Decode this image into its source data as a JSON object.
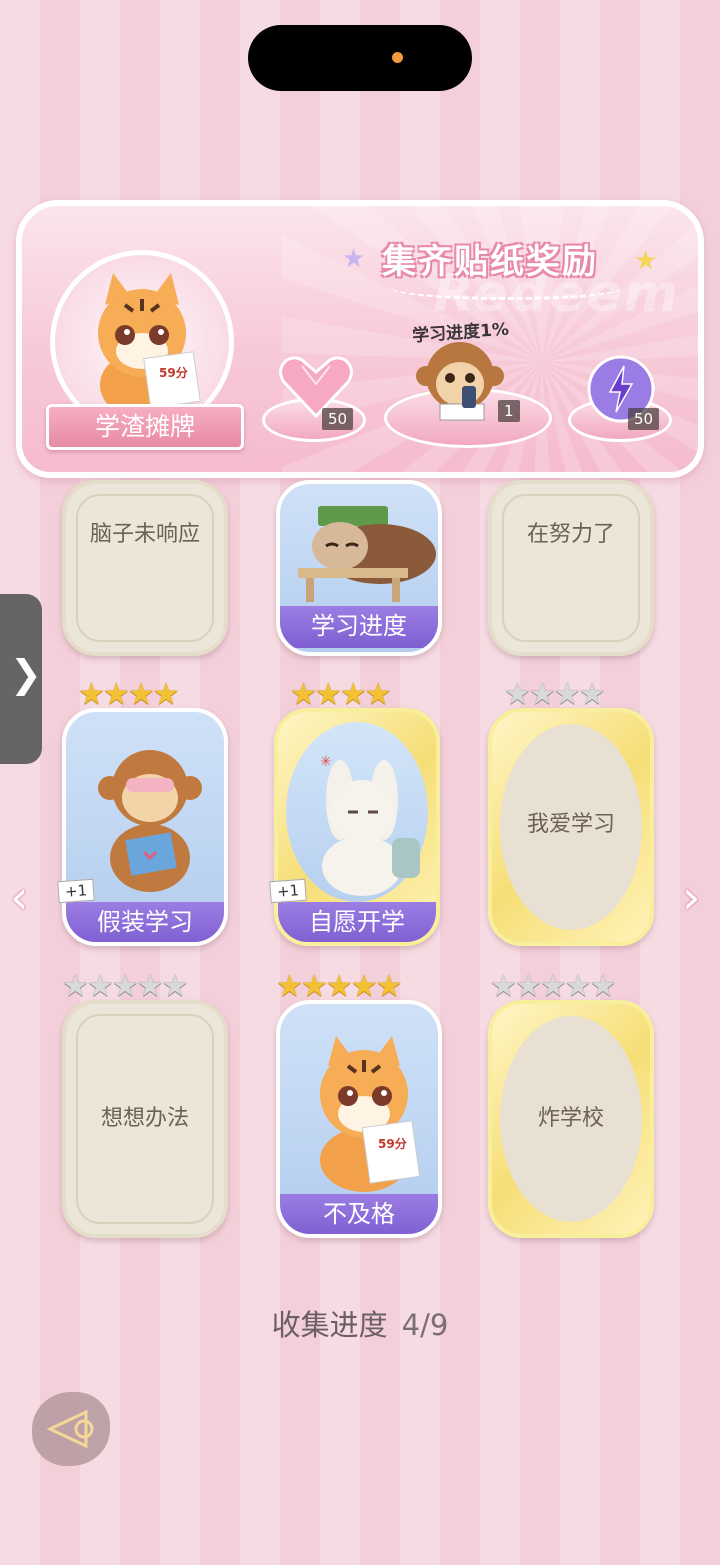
{
  "header": {
    "player_title": "学渣摊牌",
    "redeem_title": "集齐贴纸奖励",
    "progress_label": "学习进度1%",
    "rewards": [
      {
        "icon": "heart-gem-icon",
        "count": "50"
      },
      {
        "icon": "monkey-sticker-icon",
        "count": "1"
      },
      {
        "icon": "lightning-orb-icon",
        "count": "50"
      }
    ]
  },
  "cards": [
    {
      "name": "脑子未响应",
      "state": "locked"
    },
    {
      "name": "学习进度",
      "state": "owned"
    },
    {
      "name": "在努力了",
      "state": "locked"
    },
    {
      "name": "假装学习",
      "state": "owned",
      "stars": "★★★★",
      "plus": "+1"
    },
    {
      "name": "自愿开学",
      "state": "owned",
      "stars": "★★★★",
      "plus": "+1"
    },
    {
      "name": "我爱学习",
      "state": "locked",
      "stars": "★★★★"
    },
    {
      "name": "想想办法",
      "state": "locked",
      "stars": "★★★★★"
    },
    {
      "name": "不及格",
      "state": "owned",
      "stars": "★★★★★"
    },
    {
      "name": "炸学校",
      "state": "locked",
      "stars": "★★★★★"
    }
  ],
  "collect": {
    "label": "收集进度",
    "value": "4/9"
  },
  "nav": {
    "prev": "‹",
    "next": "›",
    "side": "❯"
  },
  "colors": {
    "accent": "#8a6ad8",
    "pink": "#f6cbd8"
  }
}
